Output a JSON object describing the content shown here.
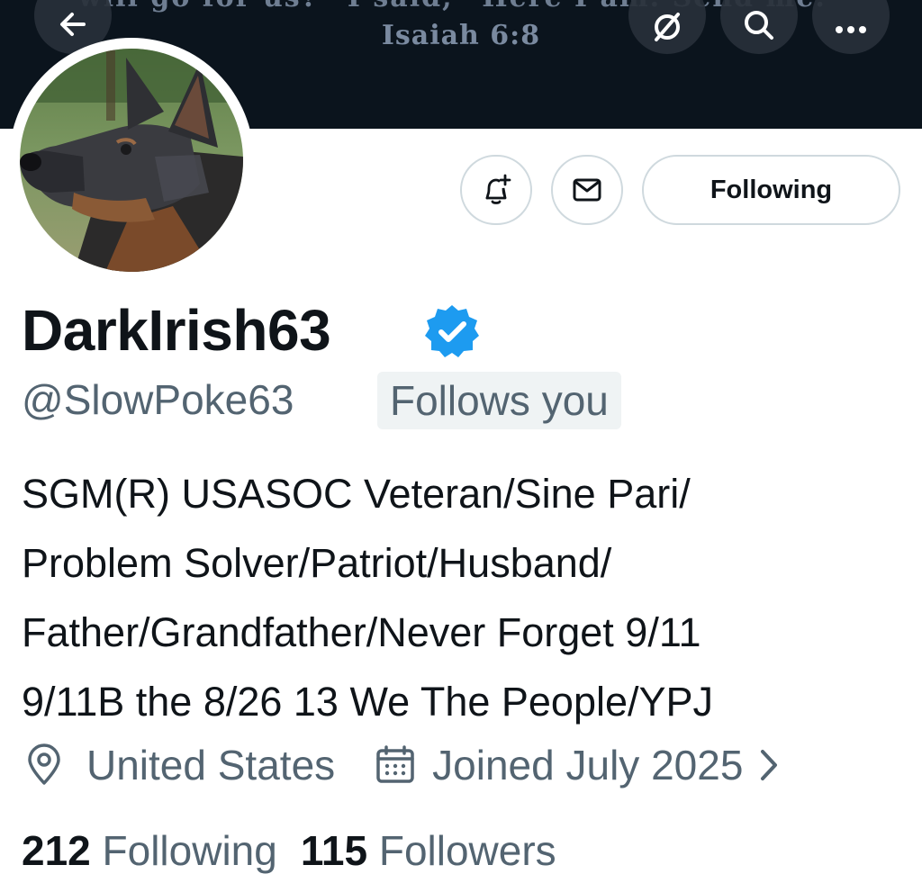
{
  "banner": {
    "top_line": "will go for us?” I said, “Here I am. Send me.”",
    "reference": "Isaiah 6:8"
  },
  "nav": {
    "back_icon": "arrow-left-icon",
    "grok_icon": "grok-icon",
    "search_icon": "search-icon",
    "more_icon": "more-icon"
  },
  "actions": {
    "notify_icon": "bell-plus-icon",
    "message_icon": "envelope-icon",
    "following_label": "Following"
  },
  "profile": {
    "display_name": "DarkIrish63",
    "handle": "@SlowPoke63",
    "follows_you": "Follows you",
    "bio_lines": [
      "SGM(R) USASOC Veteran/Sine Pari/",
      "Problem Solver/Patriot/Husband/",
      "Father/Grandfather/Never Forget 9/11",
      "9/11B the 8/26 13 We The People/YPJ"
    ],
    "location": "United States",
    "joined": "Joined July 2025",
    "following_count": "212",
    "following_label": "Following",
    "followers_count": "115",
    "followers_label": "Followers"
  },
  "colors": {
    "verified": "#1d9bf0",
    "secondary_text": "#536471",
    "banner_bg": "#0b141d"
  }
}
